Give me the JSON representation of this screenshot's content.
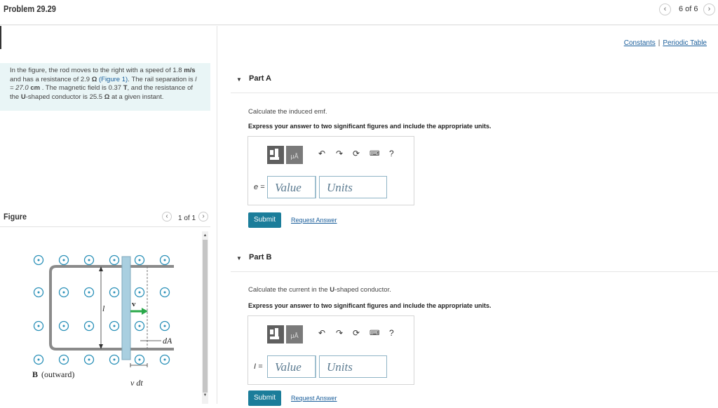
{
  "header": {
    "problem_title": "Problem 29.29",
    "pager": "6 of 6",
    "prev_icon": "chevron-left-icon",
    "next_icon": "chevron-right-icon"
  },
  "links": {
    "constants": "Constants",
    "separator": "|",
    "periodic_table": "Periodic Table"
  },
  "intro": {
    "t1": "In the figure, the rod moves to the right with a speed of 1.8",
    "unit_speed": "m/s",
    "t2": "and has a resistance of 2.9",
    "omega1": "Ω",
    "figlink": "(Figure 1)",
    "t3": ". The rail separation is",
    "l_eq": "l = 27.0",
    "unit_cm": "cm",
    "t4": ". The magnetic field is 0.37",
    "unit_T": "T",
    "t5": ", and the resistance of the",
    "ushape": "U",
    "t6": "-shaped conductor is 25.5",
    "omega2": "Ω",
    "t7": "at a given instant."
  },
  "figure": {
    "label": "Figure",
    "pager": "1 of 1",
    "labels": {
      "l": "l",
      "v": "v",
      "dA": "dA",
      "B": "B",
      "outward": "(outward)",
      "vdt": "v dt"
    }
  },
  "partA": {
    "title": "Part A",
    "prompt": "Calculate the induced emf.",
    "instruction": "Express your answer to two significant figures and include the appropriate units.",
    "var": "e =",
    "value_placeholder": "Value",
    "units_placeholder": "Units",
    "submit": "Submit",
    "request": "Request Answer"
  },
  "partB": {
    "title": "Part B",
    "prompt_1": "Calculate the current in the",
    "prompt_u": "U",
    "prompt_2": "-shaped conductor.",
    "instruction": "Express your answer to two significant figures and include the appropriate units.",
    "var": "I =",
    "value_placeholder": "Value",
    "units_placeholder": "Units",
    "submit": "Submit",
    "request": "Request Answer"
  },
  "toolbar": {
    "templates_icon": "templates-icon",
    "units_icon": "units-icon",
    "units_label": "μÅ",
    "undo_icon": "undo-icon",
    "redo_icon": "redo-icon",
    "reset_icon": "reset-icon",
    "keyboard_icon": "keyboard-icon",
    "help_label": "?"
  }
}
